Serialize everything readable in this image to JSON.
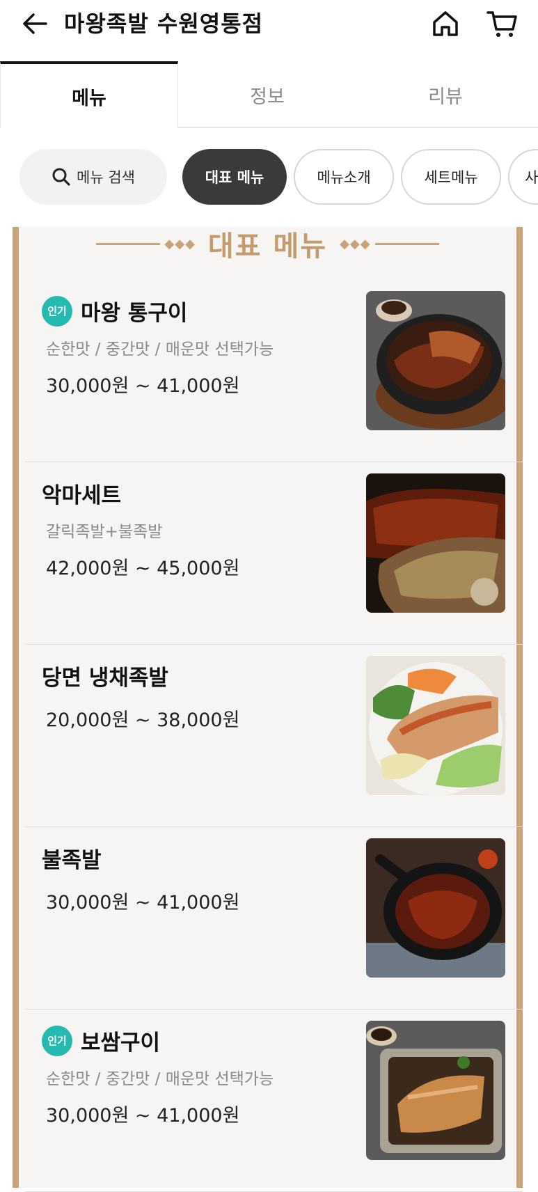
{
  "header": {
    "title": "마왕족발 수원영통점"
  },
  "tabs": [
    {
      "label": "메뉴"
    },
    {
      "label": "정보"
    },
    {
      "label": "리뷰"
    }
  ],
  "chips": {
    "search": "메뉴 검색",
    "items": [
      {
        "label": "대표 메뉴"
      },
      {
        "label": "메뉴소개"
      },
      {
        "label": "세트메뉴"
      },
      {
        "label": "사"
      }
    ]
  },
  "section": {
    "title": "대표 메뉴"
  },
  "menu": [
    {
      "badge": "인기",
      "name": "마왕 통구이",
      "desc": "순한맛 / 중간맛 / 매운맛 선택가능",
      "price": "30,000원 ~ 41,000원"
    },
    {
      "badge": "",
      "name": "악마세트",
      "desc": "갈릭족발+불족발",
      "price": "42,000원 ~ 45,000원"
    },
    {
      "badge": "",
      "name": "당면 냉채족발",
      "desc": "",
      "price": "20,000원 ~ 38,000원"
    },
    {
      "badge": "",
      "name": "불족발",
      "desc": "",
      "price": "30,000원 ~ 41,000원"
    },
    {
      "badge": "인기",
      "name": "보쌈구이",
      "desc": "순한맛 / 중간맛 / 매운맛 선택가능",
      "price": "30,000원 ~ 41,000원"
    }
  ],
  "colors": {
    "accent": "#c8a27a",
    "badge": "#25b9b0",
    "chip_active": "#3a3a3a"
  }
}
